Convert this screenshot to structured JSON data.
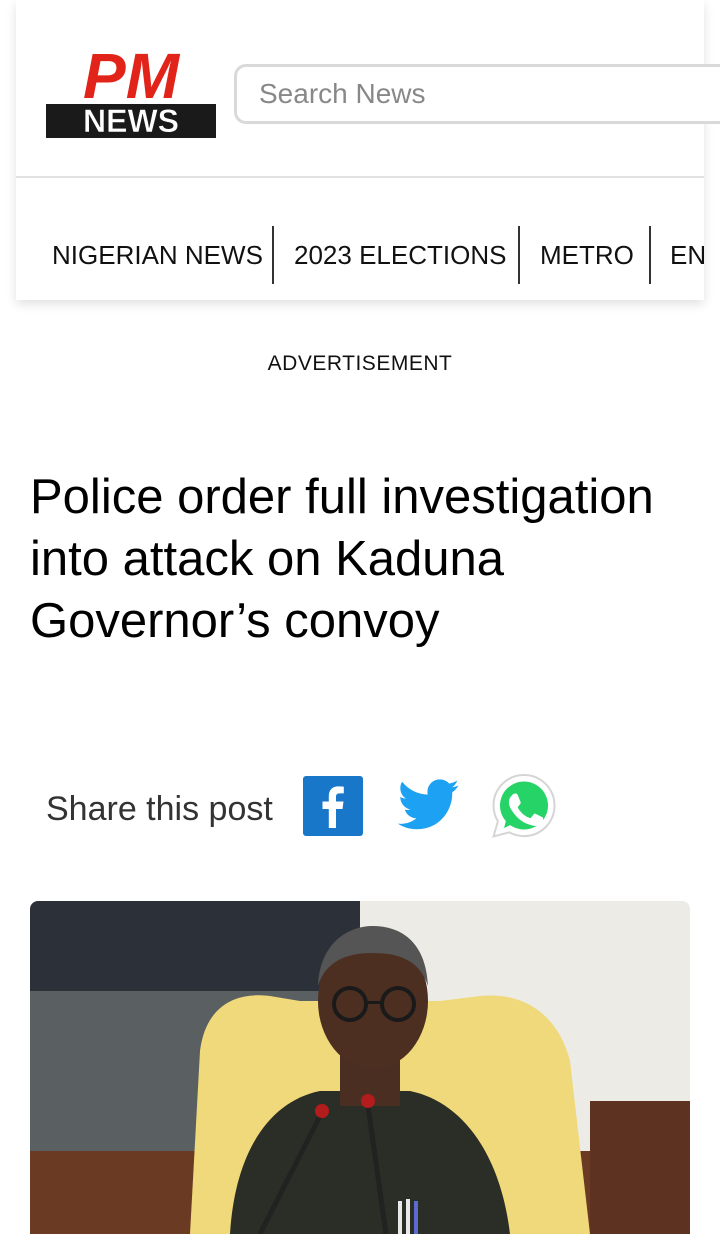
{
  "header": {
    "logo_text_top": "PM",
    "logo_text_bottom": "NEWS",
    "search_placeholder": "Search News"
  },
  "nav": {
    "items": [
      {
        "label": "NIGERIAN NEWS"
      },
      {
        "label": "2023 ELECTIONS"
      },
      {
        "label": "METRO"
      },
      {
        "label": "EN"
      }
    ]
  },
  "advertisement_label": "ADVERTISEMENT",
  "article": {
    "title": "Police order full investigation into attack on Kaduna Governor’s convoy",
    "share_label": "Share this post"
  },
  "colors": {
    "brand_red": "#e2231a",
    "facebook_blue": "#1877c9",
    "twitter_blue": "#1da1f2",
    "whatsapp_green": "#25d366"
  },
  "icons": {
    "facebook": "facebook-icon",
    "twitter": "twitter-icon",
    "whatsapp": "whatsapp-icon"
  }
}
